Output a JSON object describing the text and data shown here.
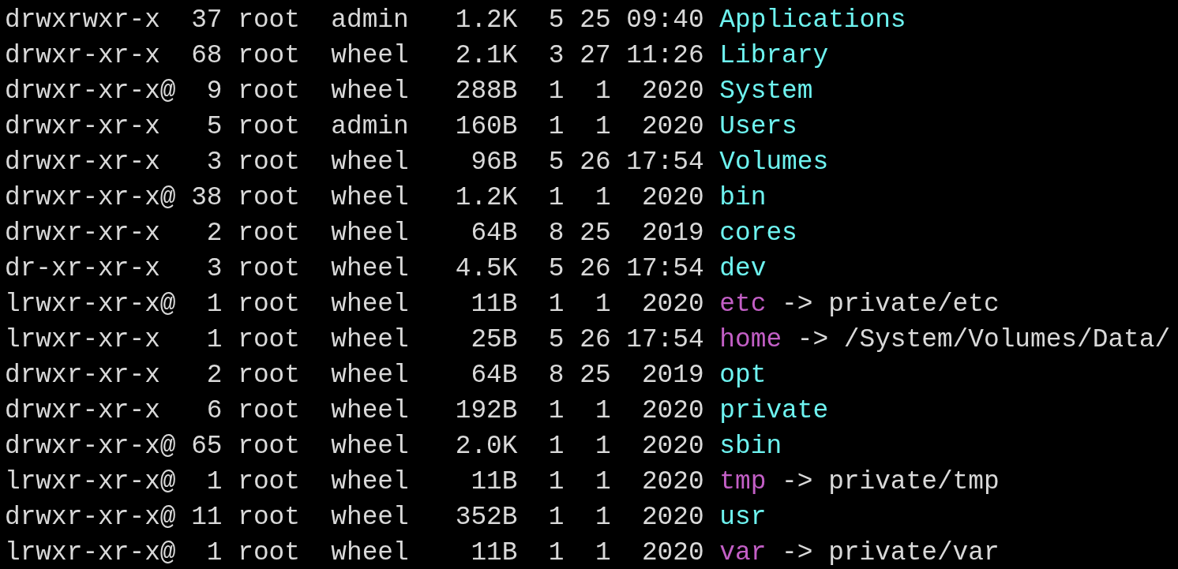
{
  "terminal": {
    "rows": [
      {
        "listing": "drwxrwxr-x  37 root  admin   1.2K  5 25 09:40",
        "name": "Applications",
        "kind": "directory"
      },
      {
        "listing": "drwxr-xr-x  68 root  wheel   2.1K  3 27 11:26",
        "name": "Library",
        "kind": "directory"
      },
      {
        "listing": "drwxr-xr-x@  9 root  wheel   288B  1  1  2020",
        "name": "System",
        "kind": "directory"
      },
      {
        "listing": "drwxr-xr-x   5 root  admin   160B  1  1  2020",
        "name": "Users",
        "kind": "directory"
      },
      {
        "listing": "drwxr-xr-x   3 root  wheel    96B  5 26 17:54",
        "name": "Volumes",
        "kind": "directory"
      },
      {
        "listing": "drwxr-xr-x@ 38 root  wheel   1.2K  1  1  2020",
        "name": "bin",
        "kind": "directory"
      },
      {
        "listing": "drwxr-xr-x   2 root  wheel    64B  8 25  2019",
        "name": "cores",
        "kind": "directory"
      },
      {
        "listing": "dr-xr-xr-x   3 root  wheel   4.5K  5 26 17:54",
        "name": "dev",
        "kind": "directory"
      },
      {
        "listing": "lrwxr-xr-x@  1 root  wheel    11B  1  1  2020",
        "name": "etc",
        "kind": "symlink",
        "target": "-> private/etc"
      },
      {
        "listing": "lrwxr-xr-x   1 root  wheel    25B  5 26 17:54",
        "name": "home",
        "kind": "symlink",
        "target": "-> /System/Volumes/Data/"
      },
      {
        "listing": "drwxr-xr-x   2 root  wheel    64B  8 25  2019",
        "name": "opt",
        "kind": "directory"
      },
      {
        "listing": "drwxr-xr-x   6 root  wheel   192B  1  1  2020",
        "name": "private",
        "kind": "directory"
      },
      {
        "listing": "drwxr-xr-x@ 65 root  wheel   2.0K  1  1  2020",
        "name": "sbin",
        "kind": "directory"
      },
      {
        "listing": "lrwxr-xr-x@  1 root  wheel    11B  1  1  2020",
        "name": "tmp",
        "kind": "symlink",
        "target": "-> private/tmp"
      },
      {
        "listing": "drwxr-xr-x@ 11 root  wheel   352B  1  1  2020",
        "name": "usr",
        "kind": "directory"
      },
      {
        "listing": "lrwxr-xr-x@  1 root  wheel    11B  1  1  2020",
        "name": "var",
        "kind": "symlink",
        "target": "-> private/var"
      }
    ]
  }
}
